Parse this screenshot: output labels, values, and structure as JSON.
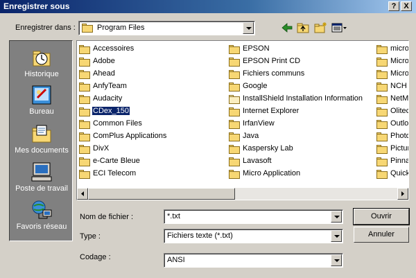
{
  "window": {
    "title": "Enregistrer sous",
    "help_glyph": "?",
    "close_glyph": "X"
  },
  "save_in": {
    "label": "Enregistrer dans :",
    "label_underline": "d",
    "value": "Program Files"
  },
  "toolbar": {
    "icons": [
      "back-icon",
      "up-folder-icon",
      "new-folder-icon",
      "view-menu-icon"
    ]
  },
  "places": [
    {
      "label": "Historique",
      "icon": "history-icon"
    },
    {
      "label": "Bureau",
      "icon": "desktop-icon"
    },
    {
      "label": "Mes documents",
      "icon": "my-documents-icon"
    },
    {
      "label": "Poste de travail",
      "icon": "my-computer-icon"
    },
    {
      "label": "Favoris réseau",
      "icon": "network-places-icon"
    }
  ],
  "files": {
    "col1": [
      "Accessoires",
      "Adobe",
      "Ahead",
      "AnfyTeam",
      "Audacity",
      "CDex_150",
      "Common Files",
      "ComPlus Applications",
      "DivX",
      "e-Carte Bleue",
      "ECI Telecom"
    ],
    "col2": [
      "EPSON",
      "EPSON Print CD",
      "Fichiers communs",
      "Google",
      "InstallShield Installation Information",
      "Internet Explorer",
      "IrfanView",
      "Java",
      "Kaspersky Lab",
      "Lavasoft",
      "Micro Application"
    ],
    "col3": [
      "micro",
      "Micro",
      "Micro",
      "NCH",
      "NetM",
      "Olitec",
      "Outlo",
      "Photo",
      "Pictur",
      "Pinna",
      "Quick"
    ],
    "selected": "CDex_150"
  },
  "filename": {
    "label": "Nom de fichier :",
    "value": "*.txt"
  },
  "type": {
    "label": "Type :",
    "value": "Fichiers texte (*.txt)"
  },
  "encoding": {
    "label": "Codage :",
    "value": "ANSI"
  },
  "buttons": {
    "open": "Ouvrir",
    "cancel": "Annuler"
  },
  "colors": {
    "title_start": "#0a246a",
    "title_end": "#a6caf0",
    "face": "#d4d0c8",
    "places_bg": "#808080",
    "selection": "#0a246a",
    "folder": "#f7d774"
  }
}
